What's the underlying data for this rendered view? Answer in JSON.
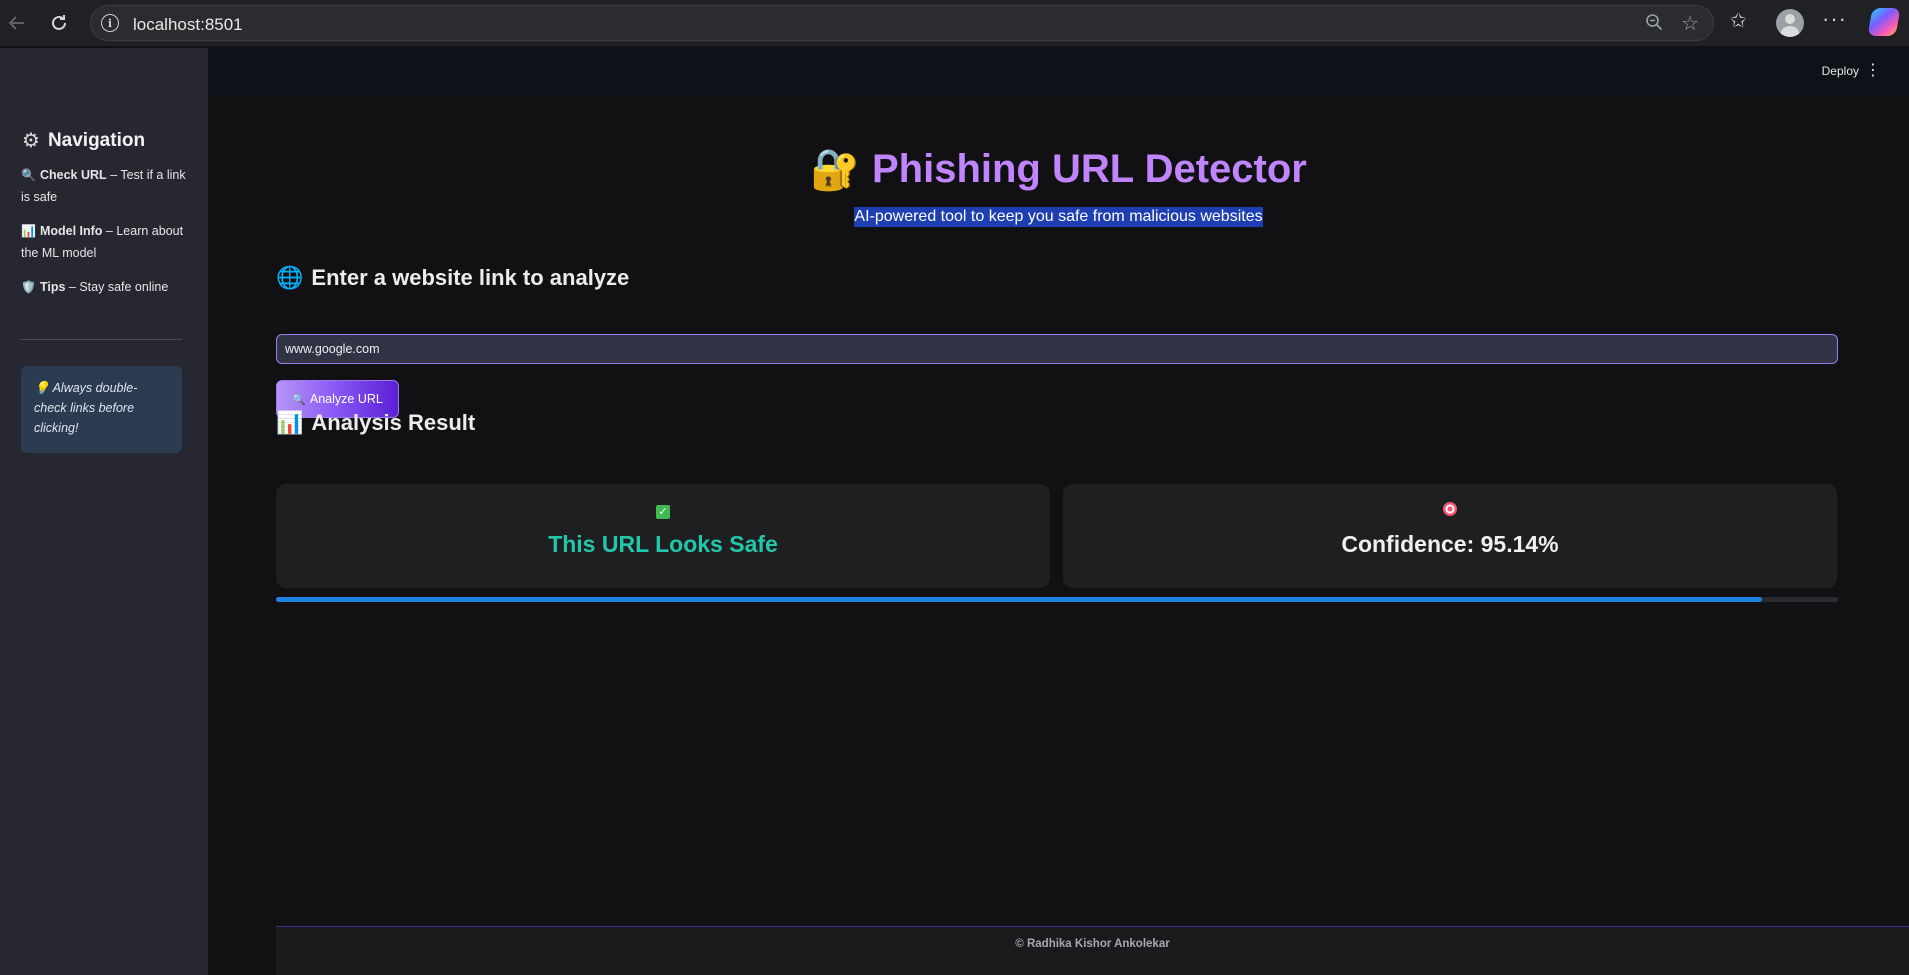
{
  "browser": {
    "url": "localhost:8501"
  },
  "sidebar": {
    "title": "Navigation",
    "items": [
      {
        "emoji": "🔍",
        "label": "Check URL",
        "desc": " – Test if a link is safe"
      },
      {
        "emoji": "📊",
        "label": "Model Info",
        "desc": " – Learn about the ML model"
      },
      {
        "emoji": "🛡️",
        "label": "Tips",
        "desc": " – Stay safe online"
      }
    ],
    "tip": {
      "emoji": "💡",
      "text": "Always double-check links before clicking!"
    }
  },
  "header": {
    "deploy_label": "Deploy"
  },
  "main": {
    "title": "Phishing URL Detector",
    "subtitle": "AI-powered tool to keep you safe from malicious websites",
    "input_heading": "Enter a website link to analyze",
    "input_value": "www.google.com",
    "analyze_emoji": "🔍",
    "analyze_label": "Analyze URL",
    "result_heading": "Analysis Result",
    "result_status": "This URL Looks Safe",
    "confidence_text": "Confidence: 95.14%",
    "confidence_value": 95.14
  },
  "footer": {
    "text": "© Radhika Kishor Ankolekar"
  },
  "colors": {
    "accent_purple": "#c084fc",
    "safe_teal": "#22c7a9",
    "progress_blue": "#1c83e1",
    "sidebar_bg": "#262730",
    "main_bg": "#111113"
  }
}
